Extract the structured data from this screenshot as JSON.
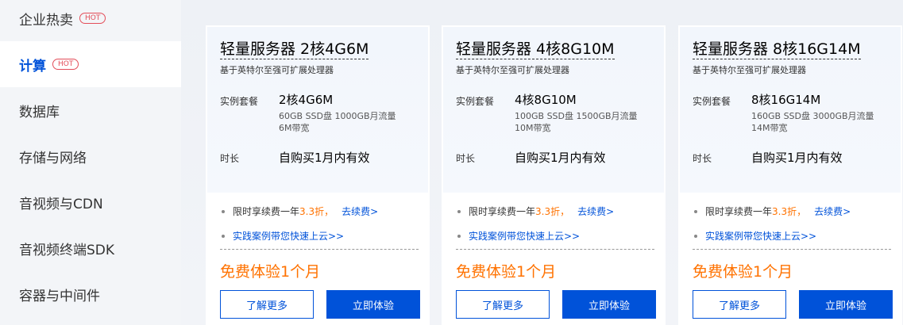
{
  "sidebar": {
    "hot_badge": "HOT",
    "items": [
      {
        "label": "企业热卖"
      },
      {
        "label": "计算"
      },
      {
        "label": "数据库"
      },
      {
        "label": "存储与网络"
      },
      {
        "label": "音视频与CDN"
      },
      {
        "label": "音视频终端SDK"
      },
      {
        "label": "容器与中间件"
      }
    ]
  },
  "cards": [
    {
      "title": "轻量服务器 2核4G6M",
      "subtitle": "基于英特尔至强可扩展处理器",
      "spec_label": "实例套餐",
      "spec_value": "2核4G6M",
      "spec_detail_1": "60GB SSD盘 1000GB月流量",
      "spec_detail_2": "6M带宽",
      "duration_label": "时长",
      "duration_value": "自购买1月内有效",
      "promo_prefix": "限时享续费一年",
      "promo_discount": "3.3折，",
      "promo_link": "去续费>",
      "case_link": "实践案例带您快速上云>>",
      "price": "免费体验1个月",
      "more_button": "了解更多",
      "try_button": "立即体验"
    },
    {
      "title": "轻量服务器 4核8G10M",
      "subtitle": "基于英特尔至强可扩展处理器",
      "spec_label": "实例套餐",
      "spec_value": "4核8G10M",
      "spec_detail_1": "100GB SSD盘 1500GB月流量",
      "spec_detail_2": "10M带宽",
      "duration_label": "时长",
      "duration_value": "自购买1月内有效",
      "promo_prefix": "限时享续费一年",
      "promo_discount": "3.3折，",
      "promo_link": "去续费>",
      "case_link": "实践案例带您快速上云>>",
      "price": "免费体验1个月",
      "more_button": "了解更多",
      "try_button": "立即体验"
    },
    {
      "title": "轻量服务器 8核16G14M",
      "subtitle": "基于英特尔至强可扩展处理器",
      "spec_label": "实例套餐",
      "spec_value": "8核16G14M",
      "spec_detail_1": "160GB SSD盘 3000GB月流量",
      "spec_detail_2": "14M带宽",
      "duration_label": "时长",
      "duration_value": "自购买1月内有效",
      "promo_prefix": "限时享续费一年",
      "promo_discount": "3.3折，",
      "promo_link": "去续费>",
      "case_link": "实践案例带您快速上云>>",
      "price": "免费体验1个月",
      "more_button": "了解更多",
      "try_button": "立即体验"
    }
  ]
}
